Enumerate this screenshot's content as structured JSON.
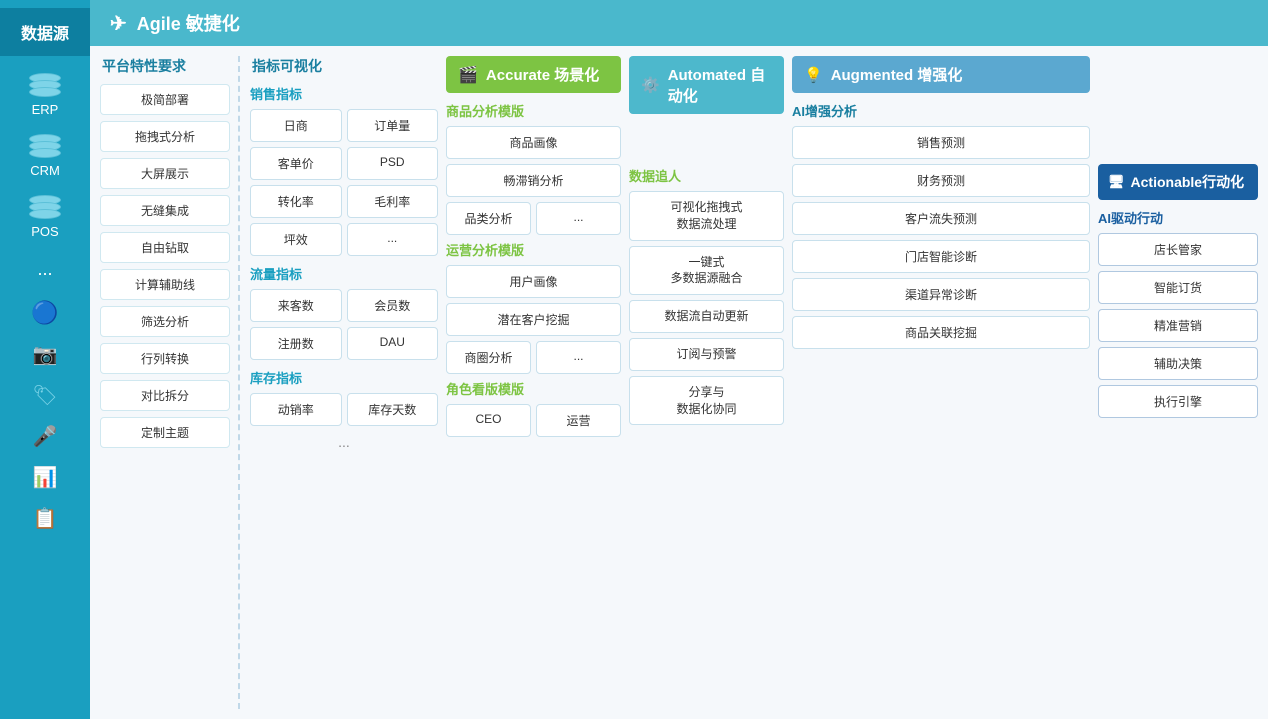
{
  "sidebar": {
    "header": "数据源",
    "items": [
      {
        "label": "ERP",
        "icon": "database-icon"
      },
      {
        "label": "CRM",
        "icon": "database-icon"
      },
      {
        "label": "POS",
        "icon": "database-icon"
      },
      {
        "label": "...",
        "icon": "dots"
      },
      {
        "label": "",
        "icon": "weibo-icon"
      },
      {
        "label": "",
        "icon": "camera-icon"
      },
      {
        "label": "",
        "icon": "tag-icon"
      },
      {
        "label": "",
        "icon": "mic-icon"
      },
      {
        "label": "",
        "icon": "excel-icon"
      },
      {
        "label": "",
        "icon": "copy-icon"
      }
    ]
  },
  "header": {
    "icon": "navigation-icon",
    "title": "Agile 敏捷化"
  },
  "platform": {
    "title": "平台特性要求",
    "items": [
      "极简部署",
      "拖拽式分析",
      "大屏展示",
      "无缝集成",
      "自由钻取",
      "计算辅助线",
      "筛选分析",
      "行列转换",
      "对比拆分",
      "定制主题"
    ]
  },
  "kpi": {
    "title": "指标可视化",
    "sections": [
      {
        "title": "销售指标",
        "items": [
          "日商",
          "订单量",
          "客单价",
          "PSD",
          "转化率",
          "毛利率",
          "坪效"
        ],
        "extra": "..."
      },
      {
        "title": "流量指标",
        "items": [
          "来客数",
          "会员数",
          "注册数",
          "DAU"
        ]
      },
      {
        "title": "库存指标",
        "items": [
          "动销率",
          "库存天数"
        ],
        "extra": "..."
      }
    ]
  },
  "accurate": {
    "header": "Accurate 场景化",
    "sections": [
      {
        "title": "商品分析模版",
        "items": [
          "商品画像",
          "畅滞销分析",
          "品类分析"
        ],
        "extra": "..."
      },
      {
        "title": "运营分析模版",
        "items": [
          "用户画像",
          "潜在客户挖掘",
          "商圈分析"
        ],
        "extra": "..."
      },
      {
        "title": "角色看版模版",
        "items": [
          "CEO",
          "运营"
        ]
      }
    ]
  },
  "automated": {
    "header": "Automated 自动化",
    "tracking_title": "数据追人",
    "tracking_items": [
      "可视化拖拽式\n数据流处理",
      "一键式\n多数据源融合",
      "数据流自动更新",
      "订阅与预警",
      "分享与\n数据化协同"
    ]
  },
  "augmented": {
    "header": "Augmented 增强化",
    "ai_title": "AI增强分析",
    "ai_items": [
      "销售预测",
      "财务预测",
      "客户流失预测",
      "门店智能诊断",
      "渠道异常诊断",
      "商品关联挖掘"
    ]
  },
  "actionable": {
    "header": "Actionable行动化",
    "ai_drive_title": "AI驱动行动",
    "ai_items": [
      "店长管家",
      "智能订货",
      "精准营销",
      "辅助决策",
      "执行引擎"
    ]
  }
}
